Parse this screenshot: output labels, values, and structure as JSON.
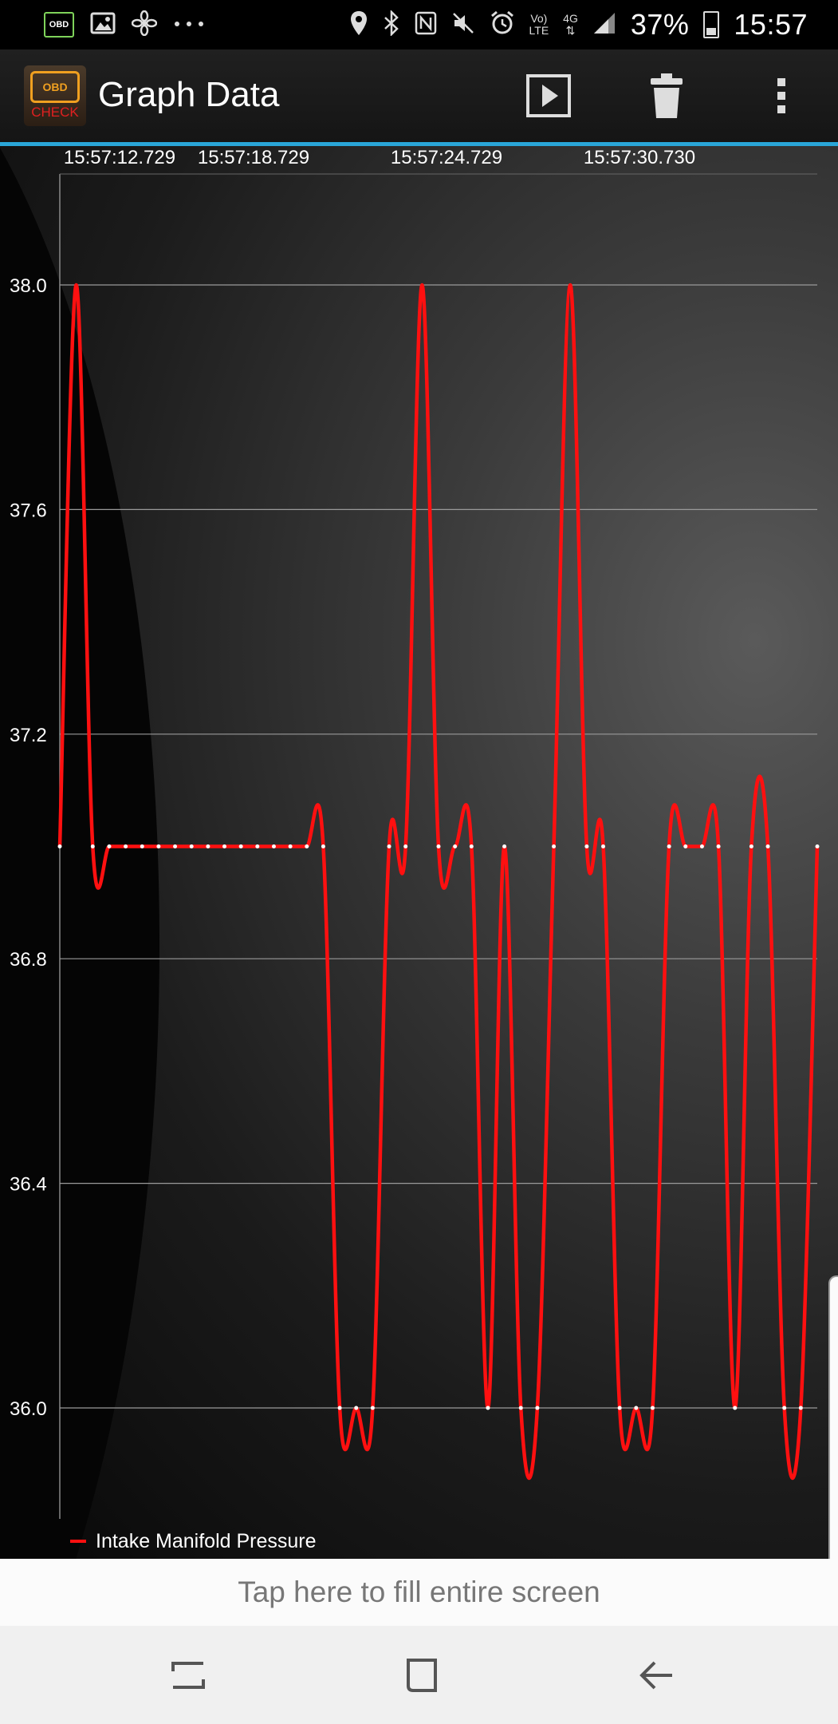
{
  "status_bar": {
    "left_icons": [
      "obd-notification-icon",
      "image-icon",
      "fan-icon",
      "more-dots-icon"
    ],
    "obd_label": "OBD",
    "network_top": "Vo)",
    "network_bottom": "LTE",
    "network_4g": "4G",
    "battery": "37%",
    "time": "15:57"
  },
  "app_bar": {
    "logo_top": "OBD",
    "logo_bottom": "CHECK",
    "title": "Graph Data"
  },
  "chart_data": {
    "type": "line",
    "x_tick_labels": [
      "15:57:12.729",
      "15:57:18.729",
      "15:57:24.729",
      "15:57:30.730"
    ],
    "y_tick_labels": [
      "38.0",
      "37.6",
      "37.2",
      "36.8",
      "36.4",
      "36.0"
    ],
    "y_ticks": [
      38.0,
      37.6,
      37.2,
      36.8,
      36.4,
      36.0
    ],
    "ylim": [
      35.8,
      38.2
    ],
    "grid": true,
    "legend_position": "bottom-left",
    "series": [
      {
        "name": "Intake Manifold Pressure",
        "color": "#ff1010",
        "values": [
          37.0,
          38.0,
          37.0,
          37.0,
          37.0,
          37.0,
          37.0,
          37.0,
          37.0,
          37.0,
          37.0,
          37.0,
          37.0,
          37.0,
          37.0,
          37.0,
          37.0,
          36.0,
          36.0,
          36.0,
          37.0,
          37.0,
          38.0,
          37.0,
          37.0,
          37.0,
          36.0,
          37.0,
          36.0,
          36.0,
          37.0,
          38.0,
          37.0,
          37.0,
          36.0,
          36.0,
          36.0,
          37.0,
          37.0,
          37.0,
          37.0,
          36.0,
          37.0,
          37.0,
          36.0,
          36.0,
          37.0
        ]
      }
    ]
  },
  "banner": {
    "text": "Tap here to fill entire screen"
  }
}
